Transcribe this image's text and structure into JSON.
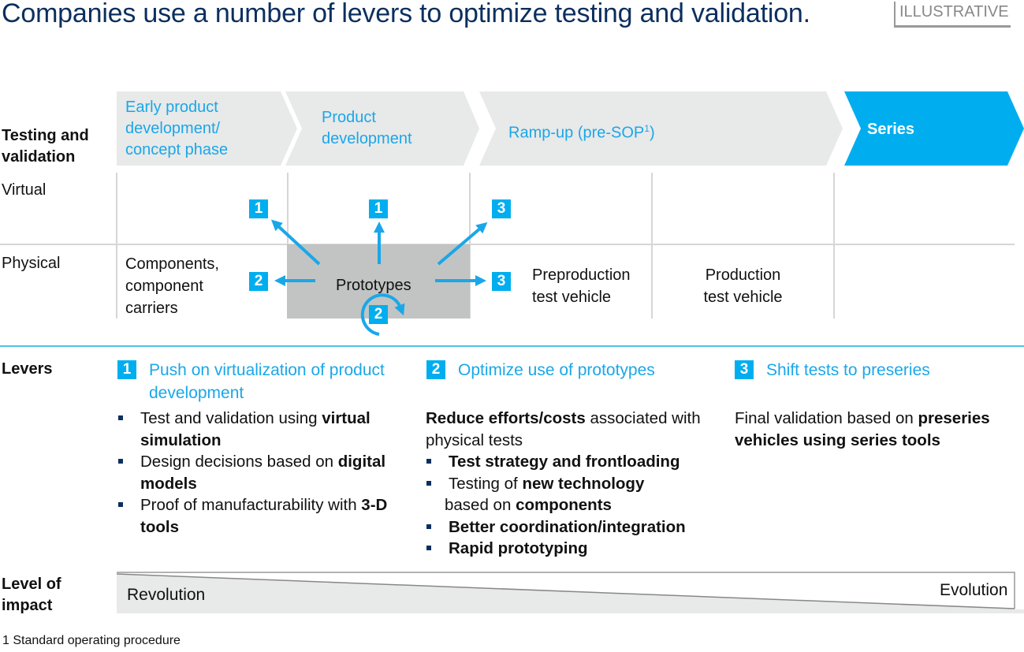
{
  "header": {
    "title": "Companies use a number of levers to optimize testing and validation.",
    "tag": "ILLUSTRATIVE"
  },
  "row_labels": {
    "testing_line1": "Testing and",
    "testing_line2": "validation",
    "virtual": "Virtual",
    "physical": "Physical",
    "levers": "Levers",
    "impact_line1": "Level of",
    "impact_line2": "impact"
  },
  "phases": [
    {
      "lines": [
        "Early product",
        "development/",
        "concept phase"
      ]
    },
    {
      "lines": [
        "Product",
        "development"
      ]
    },
    {
      "label": "Ramp-up (pre-SOP",
      "sup": "1",
      "close": ")"
    },
    {
      "label": "Series"
    }
  ],
  "colors": {
    "accent": "#00aeef",
    "title": "#0b2f5e",
    "chevron_gray": "#e8e9e9",
    "prototype_box": "#c1c4c3",
    "grid": "#d6d6d6"
  },
  "physical_cells": {
    "components": [
      "Components,",
      "component",
      "carriers"
    ],
    "prototypes": "Prototypes",
    "preproduction": [
      "Preproduction",
      "test vehicle"
    ],
    "production": [
      "Production",
      "test vehicle"
    ]
  },
  "badges": {
    "virtual_left": "1",
    "virtual_center": "1",
    "virtual_right": "3",
    "physical_left": "2",
    "physical_loop": "2",
    "physical_right": "3"
  },
  "levers": [
    {
      "number": "1",
      "title_lines": [
        "Push on virtualization of product",
        "development"
      ],
      "bullets": [
        {
          "normal": "Test and validation using ",
          "bold": "virtual simulation"
        },
        {
          "normal": "Design decisions based on ",
          "bold": "digital models"
        },
        {
          "normal": "Proof of manufacturability with ",
          "bold": "3-D tools"
        }
      ]
    },
    {
      "number": "2",
      "title": "Optimize use of prototypes",
      "intro_bold": "Reduce efforts/costs",
      "intro_normal": " associated with physical tests",
      "bullets": [
        {
          "bold": "Test strategy and frontloading"
        },
        {
          "normal": "Testing of ",
          "bold": "new technology",
          "normal2": " based on ",
          "bold2": "components"
        },
        {
          "bold": "Better coordination/integration"
        },
        {
          "bold": "Rapid prototyping"
        }
      ]
    },
    {
      "number": "3",
      "title": "Shift tests to preseries",
      "intro_normal": "Final validation based on ",
      "intro_bold": "preseries vehicles using series tools"
    }
  ],
  "impact": {
    "left": "Revolution",
    "right": "Evolution"
  },
  "footnote": "1 Standard operating procedure"
}
